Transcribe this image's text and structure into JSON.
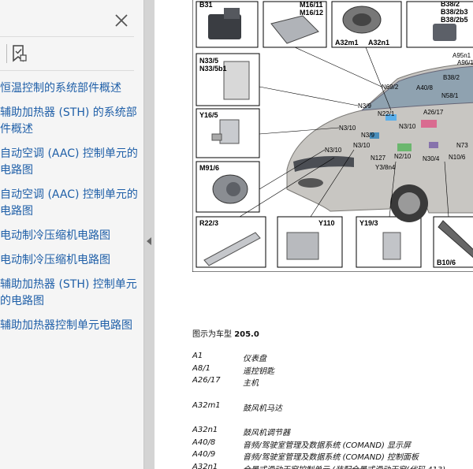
{
  "sidebar": {
    "outline": [
      "恒温控制的系统部件概述",
      "辅助加热器 (STH) 的系统部件概述",
      "自动空调 (AAC) 控制单元的电路图",
      "自动空调 (AAC) 控制单元的电路图",
      "电动制冷压缩机电路图",
      "电动制冷压缩机电路图",
      "辅助加热器 (STH) 控制单元的电路图",
      "辅助加热器控制单元电路图"
    ]
  },
  "figure": {
    "labels": {
      "b31": "B31",
      "m16": "M16/11",
      "m16b": "M16/12",
      "a32m1": "A32m1",
      "a32n1_top": "A32n1",
      "b38": "B38/2",
      "b38b": "B38/2b3",
      "b38c": "B38/2b5",
      "n33": "N33/5",
      "n33b": "N33/5b1",
      "y16": "Y16/5",
      "m91": "M91/6",
      "r22": "R22/3",
      "y110": "Y110",
      "y19": "Y19/3",
      "b10": "B10/6",
      "a95": "A95n1",
      "a96": "A96/1",
      "n69": "N69/2",
      "a40": "A40/8",
      "b38p": "B38/2",
      "n58": "N58/1",
      "n39": "N3/9",
      "n22": "N22/1",
      "a26": "A26/17",
      "n310a": "N3/10",
      "n310b": "N3/10",
      "n310c": "N3/10",
      "n310d": "N3/10",
      "n39b": "N3/9",
      "n73": "N73",
      "n127": "N127",
      "n210": "N2/10",
      "n304": "N30/4",
      "n106": "N10/6",
      "y38": "Y3/8n4"
    }
  },
  "caption": {
    "prefix": "图示为车型",
    "model": "205.0"
  },
  "legend": [
    {
      "code": "A1",
      "desc": "仪表盘"
    },
    {
      "code": "A8/1",
      "desc": "遥控钥匙"
    },
    {
      "code": "A26/17",
      "desc": "主机"
    },
    {
      "code": "A32m1",
      "desc": "鼓风机马达"
    },
    {
      "code": "A32n1",
      "desc": "鼓风机调节器"
    },
    {
      "code": "A40/8",
      "desc": "音频/驾驶室管理及数据系统 (COMAND) 显示屏"
    },
    {
      "code": "A40/9",
      "desc": "音频/驾驶室管理及数据系统 (COMAND) 控制面板"
    },
    {
      "code": "A32n1",
      "desc": "全景式滑动天窗控制单元 (装配全景式滑动天窗(代码 413)"
    }
  ]
}
